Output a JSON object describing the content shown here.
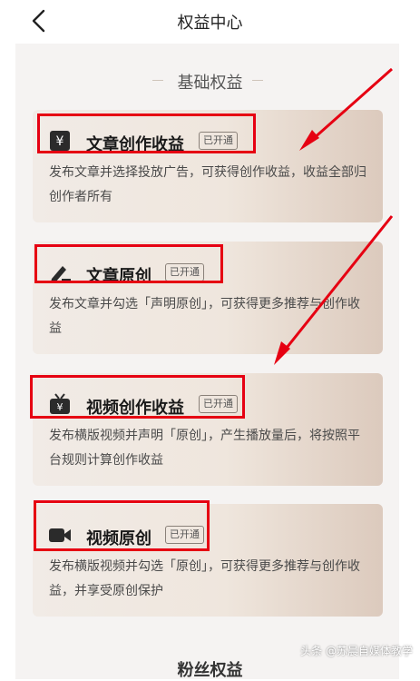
{
  "header": {
    "title": "权益中心"
  },
  "section": {
    "title": "基础权益"
  },
  "cards": [
    {
      "name": "文章创作收益",
      "badge": "已开通",
      "desc": "发布文章并选择投放广告，可获得创作收益，收益全部归创作者所有",
      "icon": "yen-icon"
    },
    {
      "name": "文章原创",
      "badge": "已开通",
      "desc": "发布文章并勾选「声明原创」，可获得更多推荐与创作收益",
      "icon": "pen-icon"
    },
    {
      "name": "视频创作收益",
      "badge": "已开通",
      "desc": "发布横版视频并声明「原创」，产生播放量后，将按照平台规则计算创作收益",
      "icon": "tv-icon"
    },
    {
      "name": "视频原创",
      "badge": "已开通",
      "desc": "发布横版视频并勾选「原创」，可获得更多推荐与创作收益，并享受原创保护",
      "icon": "video-camera-icon"
    }
  ],
  "next_section": {
    "title": "粉丝权益"
  },
  "watermark": "头条 @苏晨自媒体教学",
  "colors": {
    "highlight": "#e60012",
    "card_gradient_end": "#dccabd"
  }
}
